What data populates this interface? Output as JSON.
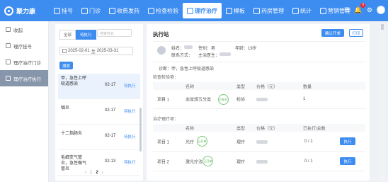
{
  "app": {
    "name": "聚力康"
  },
  "nav": [
    {
      "label": "挂号",
      "icon": "user-plus-icon",
      "active": false
    },
    {
      "label": "门诊",
      "icon": "clinic-icon",
      "active": false
    },
    {
      "label": "收费发药",
      "icon": "pay-icon",
      "active": false
    },
    {
      "label": "检查检验",
      "icon": "lab-icon",
      "active": false
    },
    {
      "label": "理疗治疗",
      "icon": "therapy-icon",
      "active": true
    },
    {
      "label": "模板",
      "icon": "template-icon",
      "active": false
    },
    {
      "label": "药房管理",
      "icon": "pharmacy-icon",
      "active": false
    },
    {
      "label": "统计",
      "icon": "chart-icon",
      "active": false
    },
    {
      "label": "营销管理",
      "icon": "marketing-icon",
      "active": false
    }
  ],
  "toolbar": {
    "notify_count": "0"
  },
  "sidebar": {
    "collapse_label": "收起",
    "items": [
      {
        "label": "理疗挂号",
        "active": false
      },
      {
        "label": "理疗治疗门诊",
        "active": false
      },
      {
        "label": "理疗治疗执行",
        "active": true
      }
    ]
  },
  "list": {
    "seg_all": "全部",
    "seg_pending": "待执行",
    "search_placeholder": "搜索姓名",
    "date_start": "2025-02-01",
    "date_sep": "至",
    "date_end": "2025-03-31",
    "search_button": "搜索",
    "rows": [
      {
        "name": "甲，急性上呼吸道感染",
        "date": "02-17",
        "status": "待执行"
      },
      {
        "name": "咽炎",
        "date": "02-17",
        "status": "待执行"
      },
      {
        "name": "十二指肠炎",
        "date": "02-17",
        "status": "待执行"
      },
      {
        "name": "毛细支气管炎，急性喉气管炎",
        "date": "02-13",
        "status": "待执行"
      }
    ],
    "pager": {
      "prev": "‹",
      "page1": "1",
      "page2": "2",
      "next": "›"
    }
  },
  "detail": {
    "title": "执行站",
    "btn_confirm": "确认开单",
    "btn_print": "打印",
    "patient": {
      "name_label": "姓名：",
      "gender_label": "性别：",
      "gender": "男",
      "age_label": "年龄：",
      "age": "19岁",
      "phone_label": "联系方式：",
      "doctor_label": "主治医生："
    },
    "diagnosis": "诊断：甲，急性上呼吸道感染",
    "exam_section": "检查检验项：",
    "exam_headers": [
      "名称",
      "类型",
      "价格（元）",
      "数量"
    ],
    "exam_rows": [
      {
        "item": "项目 1",
        "name": "血常规五分类",
        "type": "检验",
        "qty": "1",
        "stamp": "已执行"
      }
    ],
    "therapy_section": "治疗理疗项：",
    "therapy_headers": [
      "名称",
      "类型",
      "价格（元）",
      "已执行/总数"
    ],
    "therapy_rows": [
      {
        "item": "项目 1",
        "name": "光疗",
        "type": "理疗",
        "progress": "0 / 1",
        "stamp": "已开单",
        "action": "执行"
      },
      {
        "item": "项目 2",
        "name": "激光疗法",
        "type": "理疗",
        "progress": "0 / 1",
        "stamp": "已开单",
        "action": "执行"
      }
    ]
  },
  "colors": {
    "primary": "#3d8cf0",
    "sidebar_active": "#8896ab",
    "stamp_green": "#52b152"
  }
}
